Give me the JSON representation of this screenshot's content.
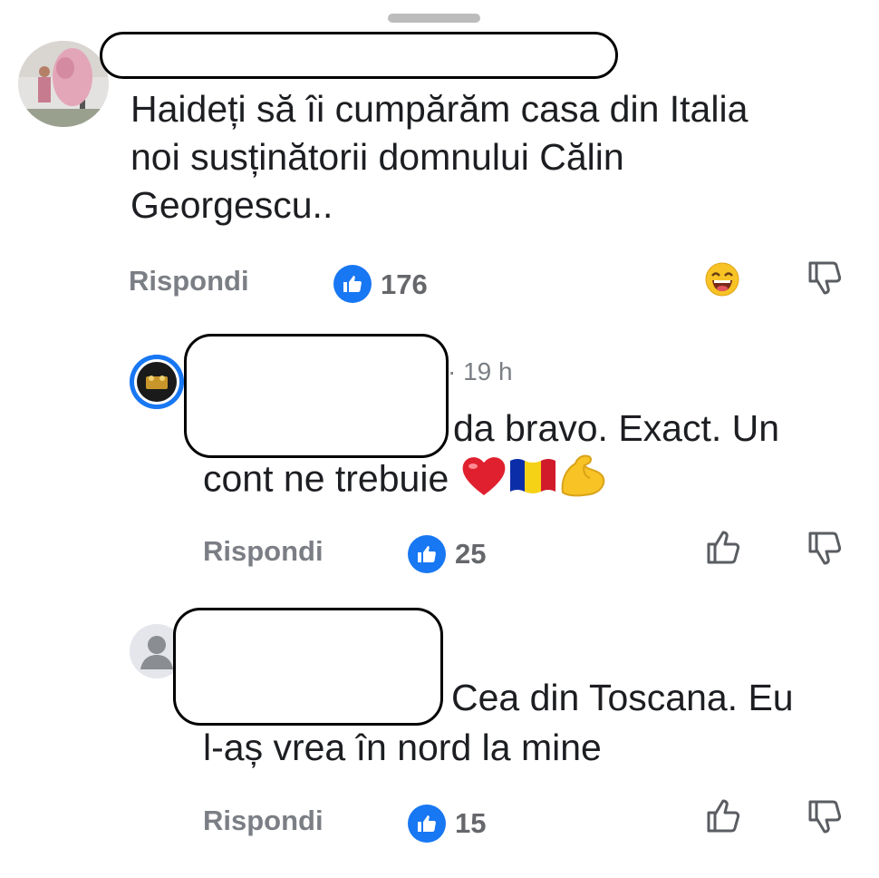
{
  "sheet": {
    "grabber": "drag-handle"
  },
  "colors": {
    "like_blue": "#1877f2",
    "muted": "#65676b",
    "text": "#1c1e21"
  },
  "comments": [
    {
      "author": "",
      "lines": [
        "Haideți să îi cumpărăm casa din Italia",
        "noi susținătorii domnului Călin",
        "Georgescu.."
      ],
      "reply_label": "Rispondi",
      "likes": "176",
      "reaction_icon": "grinning-face-emoji",
      "dislike_icon": "thumbs-down-icon"
    },
    {
      "author": "",
      "time": "· 19 h",
      "lines": [
        "da bravo. Exact. Un",
        "cont ne trebuie"
      ],
      "emojis": [
        "red-heart-emoji",
        "romania-flag-emoji",
        "flexed-biceps-emoji"
      ],
      "reply_label": "Rispondi",
      "likes": "25",
      "like_icon": "thumbs-up-icon",
      "dislike_icon": "thumbs-down-icon"
    },
    {
      "author": "",
      "lines": [
        "Cea din Toscana. Eu",
        "l-aș vrea în nord la mine"
      ],
      "reply_label": "Rispondi",
      "likes": "15",
      "like_icon": "thumbs-up-icon",
      "dislike_icon": "thumbs-down-icon"
    }
  ]
}
